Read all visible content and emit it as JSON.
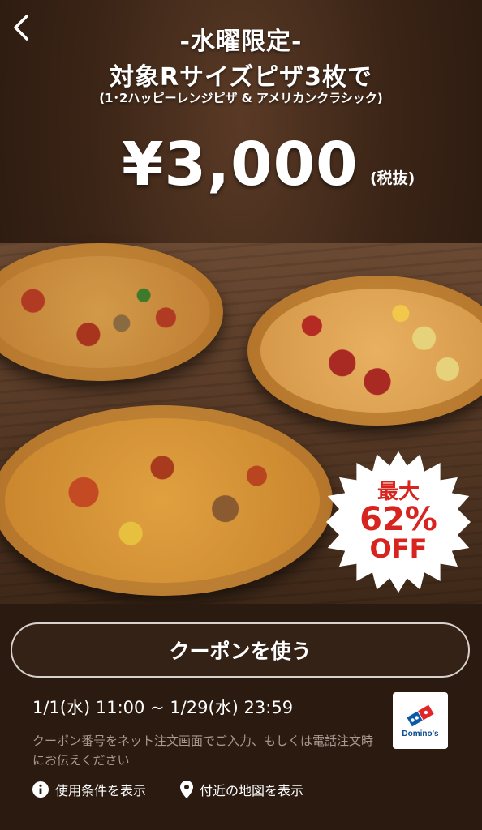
{
  "header": {
    "line1": "-水曜限定-",
    "line2": "対象Rサイズピザ3枚で",
    "line3": "(1･2ハッピーレンジピザ & アメリカンクラシック)",
    "price": "¥3,000",
    "tax_note": "(税抜)"
  },
  "badge": {
    "line1": "最大",
    "line2": "62%",
    "line3": "OFF",
    "color": "#d8241e"
  },
  "coupon": {
    "button_label": "クーポンを使う",
    "period": "1/1(水) 11:00 ~ 1/29(水) 23:59",
    "note": "クーポン番号をネット注文画面でご入力、もしくは電話注文時にお伝えください"
  },
  "logo": {
    "text": "Domino's",
    "icon": "dominos-logo-icon"
  },
  "links": {
    "terms": "使用条件を表示",
    "map": "付近の地図を表示"
  },
  "colors": {
    "background": "#2a1a10",
    "accent_blue": "#0a4a8c",
    "accent_red": "#e0262a"
  }
}
